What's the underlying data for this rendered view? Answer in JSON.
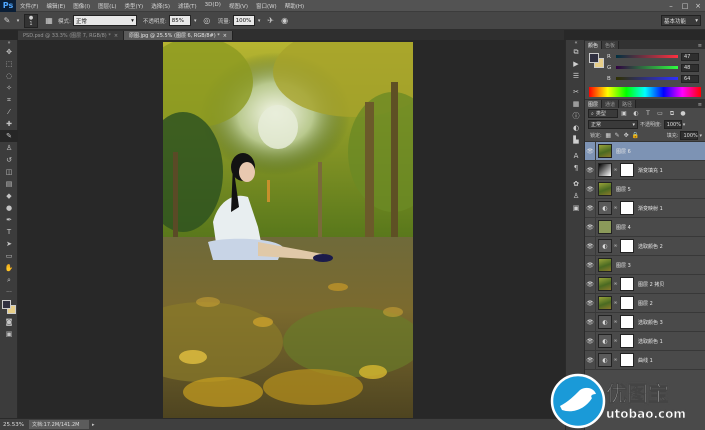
{
  "app": {
    "logo_text": "Ps"
  },
  "menu": [
    "文件(F)",
    "编辑(E)",
    "图像(I)",
    "图层(L)",
    "类型(Y)",
    "选择(S)",
    "滤镜(T)",
    "3D(D)",
    "视图(V)",
    "窗口(W)",
    "帮助(H)"
  ],
  "options": {
    "brush_size": "1",
    "mode_label": "模式:",
    "mode_value": "正常",
    "opacity_label": "不透明度:",
    "opacity_value": "85%",
    "flow_label": "流量:",
    "flow_value": "100%",
    "workspace": "基本功能"
  },
  "tabs": [
    {
      "label": "PSD.psd @ 33.3% (图层 7, RGB/8) *"
    },
    {
      "label": "原图.jpg @ 25.5% (图层 6, RGB/8#) *"
    }
  ],
  "status": {
    "zoom": "25.53%",
    "doc": "文档:17.2M/141.2M"
  },
  "color_panel": {
    "tabs": [
      "颜色",
      "色板"
    ],
    "channels": [
      {
        "label": "R",
        "value": "47"
      },
      {
        "label": "G",
        "value": "48"
      },
      {
        "label": "B",
        "value": "64"
      }
    ]
  },
  "layers_panel": {
    "tabs": [
      "图层",
      "通道",
      "路径"
    ],
    "kind_label": "类型",
    "blend_mode": "正常",
    "opacity_label": "不透明度:",
    "opacity_value": "100%",
    "lock_label": "锁定:",
    "fill_label": "填充:",
    "fill_value": "100%",
    "layers": [
      {
        "name": "图层 6",
        "thumb": "photo",
        "mask": false,
        "selected": true
      },
      {
        "name": "渐变填充 1",
        "thumb": "gradient",
        "mask": true,
        "selected": false
      },
      {
        "name": "图层 5",
        "thumb": "photo",
        "mask": false,
        "selected": false
      },
      {
        "name": "渐变映射 1",
        "thumb": "adjust",
        "mask": true,
        "selected": false
      },
      {
        "name": "图层 4",
        "thumb": "olive",
        "mask": false,
        "selected": false
      },
      {
        "name": "选取颜色 2",
        "thumb": "adjust",
        "mask": true,
        "selected": false
      },
      {
        "name": "图层 3",
        "thumb": "photo",
        "mask": false,
        "selected": false
      },
      {
        "name": "图层 2 拷贝",
        "thumb": "photo",
        "mask": true,
        "selected": false
      },
      {
        "name": "图层 2",
        "thumb": "photo",
        "mask": true,
        "selected": false
      },
      {
        "name": "选取颜色 3",
        "thumb": "adjust",
        "mask": true,
        "selected": false
      },
      {
        "name": "选取颜色 1",
        "thumb": "adjust",
        "mask": true,
        "selected": false
      },
      {
        "name": "曲线 1",
        "thumb": "adjust",
        "mask": true,
        "selected": false
      }
    ]
  },
  "watermark": {
    "cn": "优图宝",
    "en": "utobao.com"
  }
}
